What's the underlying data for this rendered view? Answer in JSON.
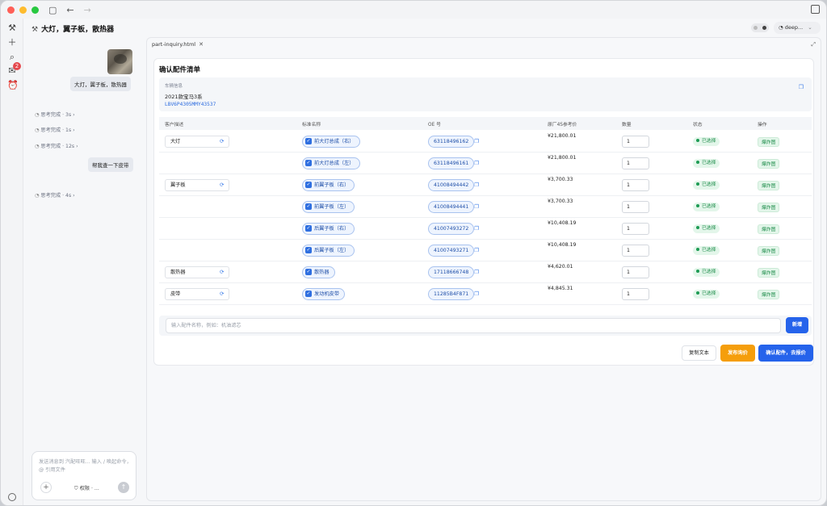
{
  "chat": {
    "title": "大灯，翼子板，散热器",
    "messages": [
      {
        "type": "user",
        "text": "大灯，翼子板，散热器"
      },
      {
        "type": "thinking",
        "text": "思考完成 · 3s"
      },
      {
        "type": "thinking",
        "text": "思考完成 · 1s"
      },
      {
        "type": "thinking",
        "text": "思考完成 · 12s"
      },
      {
        "type": "user",
        "text": "帮我查一下皮带"
      },
      {
        "type": "thinking",
        "text": "思考完成 · 4s"
      }
    ],
    "composer_placeholder": "发送消息到 汽配旺旺... 输入 / 唤起命令，@ 引用文件",
    "permission_label": "权限 · ...",
    "inbox_badge": "2"
  },
  "topbar": {
    "model_label": "deep..."
  },
  "tab": {
    "filename": "part-inquiry.html"
  },
  "card": {
    "title": "确认配件清单",
    "vehicle": {
      "label": "车辆信息",
      "model": "2021款宝马3系",
      "vin": "LBV6P4305MMY43537"
    },
    "columns": {
      "desc": "客户描述",
      "name": "标准名称",
      "oe": "OE 号",
      "price": "原厂4S参考价",
      "qty": "数量",
      "status": "状态",
      "action": "操作"
    },
    "rows": [
      {
        "desc": "大灯",
        "name": "前大灯总成（右）",
        "oe": "63118496162",
        "price": "¥21,800.01",
        "qty": "1",
        "status": "已选择",
        "action": "爆炸图"
      },
      {
        "desc": "",
        "name": "前大灯总成（左）",
        "oe": "63118496161",
        "price": "¥21,800.01",
        "qty": "1",
        "status": "已选择",
        "action": "爆炸图"
      },
      {
        "desc": "翼子板",
        "name": "前翼子板（右）",
        "oe": "41008494442",
        "price": "¥3,700.33",
        "qty": "1",
        "status": "已选择",
        "action": "爆炸图"
      },
      {
        "desc": "",
        "name": "前翼子板（左）",
        "oe": "41008494441",
        "price": "¥3,700.33",
        "qty": "1",
        "status": "已选择",
        "action": "爆炸图"
      },
      {
        "desc": "",
        "name": "后翼子板（右）",
        "oe": "41007493272",
        "price": "¥10,408.19",
        "qty": "1",
        "status": "已选择",
        "action": "爆炸图"
      },
      {
        "desc": "",
        "name": "后翼子板（左）",
        "oe": "41007493271",
        "price": "¥10,408.19",
        "qty": "1",
        "status": "已选择",
        "action": "爆炸图"
      },
      {
        "desc": "散热器",
        "name": "散热器",
        "oe": "17118666748",
        "price": "¥4,620.01",
        "qty": "1",
        "status": "已选择",
        "action": "爆炸图"
      },
      {
        "desc": "皮带",
        "name": "发动机皮带",
        "oe": "11285B4F871",
        "price": "¥4,845.31",
        "qty": "1",
        "status": "已选择",
        "action": "爆炸图"
      }
    ],
    "add_placeholder": "输入配件名称，例如：机油滤芯",
    "add_button": "新增",
    "copy_button": "复制文本",
    "publish_button": "发布询价",
    "confirm_button": "确认配件，去报价"
  },
  "icons": [
    "sidebar-toggle-icon",
    "back-arrow-icon",
    "forward-arrow-icon",
    "new-chat-icon",
    "search-icon",
    "inbox-icon",
    "clock-icon",
    "settings-icon",
    "copy-icon",
    "refresh-icon",
    "check-icon",
    "close-icon",
    "expand-icon"
  ]
}
